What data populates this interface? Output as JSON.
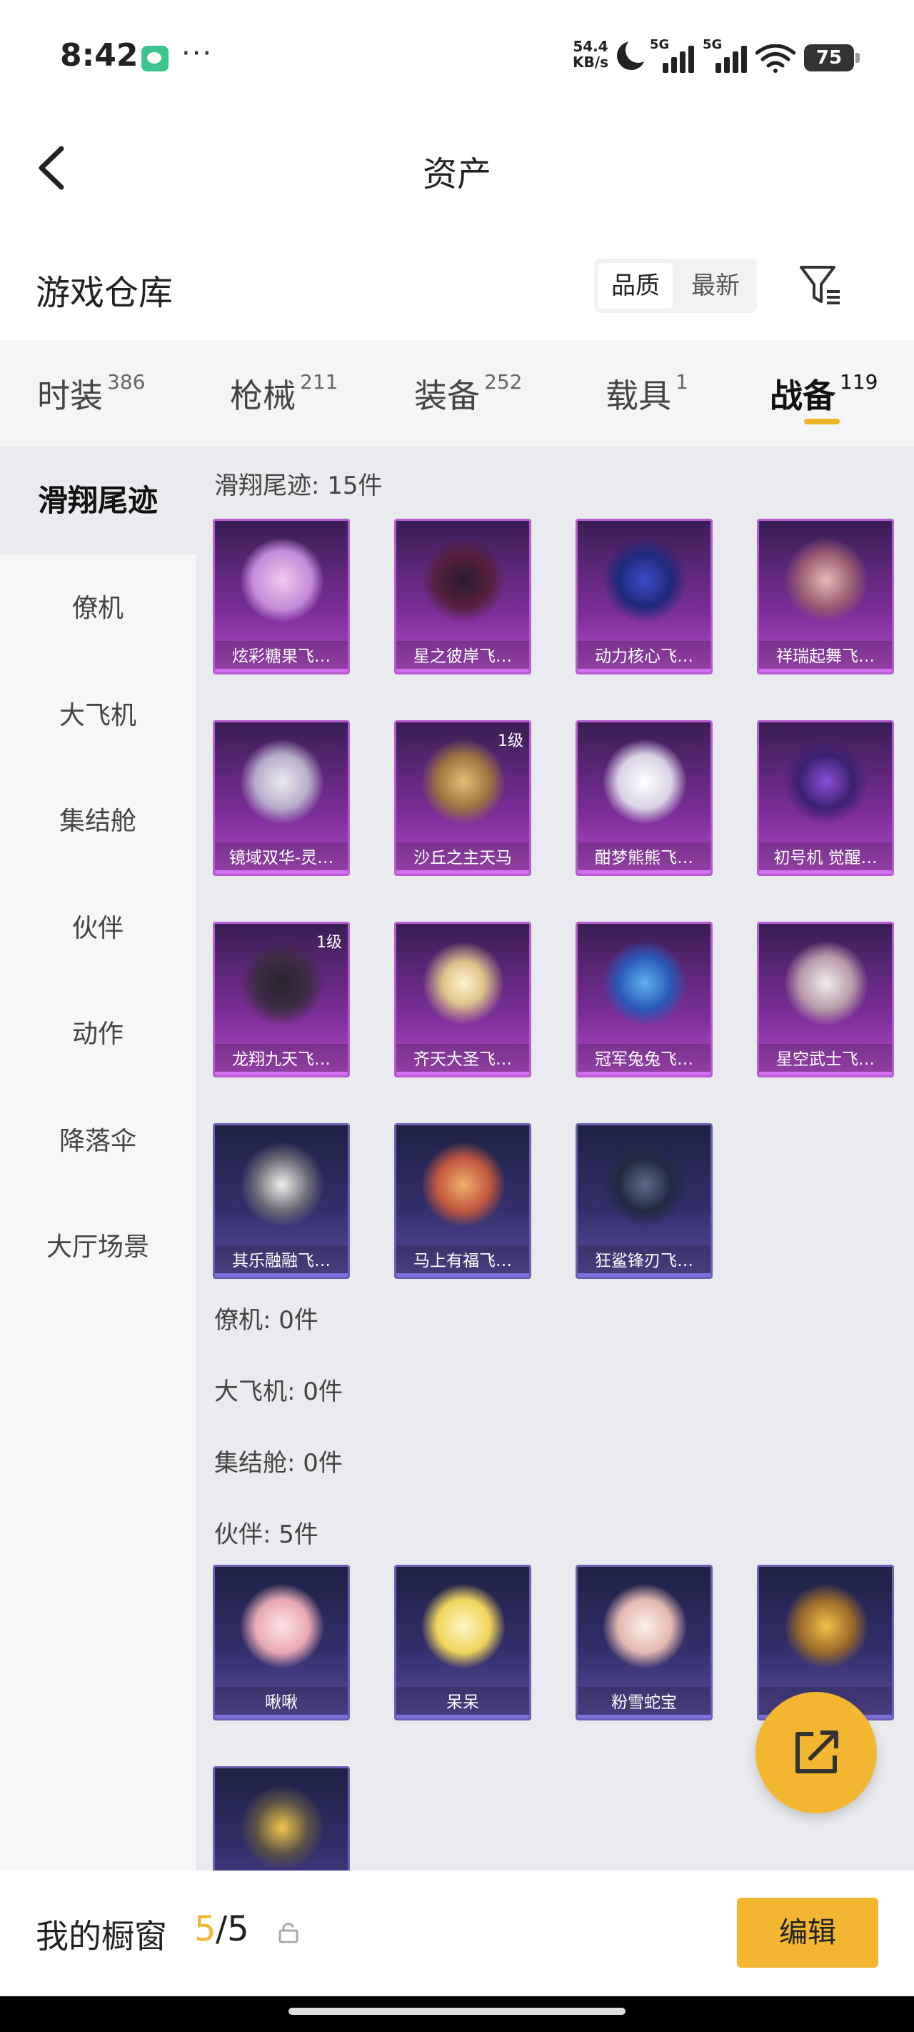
{
  "status_bar": {
    "time": "8:42",
    "dots": "···",
    "net_speed_value": "54.4",
    "net_speed_unit": "KB/s",
    "signal1_label": "5G",
    "signal2_label": "5G",
    "battery": "75",
    "icons": [
      "wechat-icon",
      "moon-icon",
      "signal-icon",
      "wifi-icon",
      "battery-icon"
    ]
  },
  "header": {
    "title": "资产",
    "back_icon": "chevron-left-icon"
  },
  "warehouse": {
    "title": "游戏仓库",
    "sort_quality": "品质",
    "sort_newest": "最新",
    "active_sort": "品质"
  },
  "tabs": [
    {
      "label": "时装",
      "count": "386"
    },
    {
      "label": "枪械",
      "count": "211"
    },
    {
      "label": "装备",
      "count": "252"
    },
    {
      "label": "载具",
      "count": "1"
    },
    {
      "label": "战备",
      "count": "119",
      "active": true
    }
  ],
  "sidebar": [
    "滑翔尾迹",
    "僚机",
    "大飞机",
    "集结舱",
    "伙伴",
    "动作",
    "降落伞",
    "大厅场景"
  ],
  "sections": {
    "trail": {
      "label": "滑翔尾迹: 15件",
      "items": [
        {
          "name": "炫彩糖果飞…",
          "level": ""
        },
        {
          "name": "星之彼岸飞…",
          "level": ""
        },
        {
          "name": "动力核心飞…",
          "level": ""
        },
        {
          "name": "祥瑞起舞飞…",
          "level": ""
        },
        {
          "name": "镜域双华-灵…",
          "level": ""
        },
        {
          "name": "沙丘之主天马",
          "level": "1级"
        },
        {
          "name": "酣梦熊熊飞…",
          "level": ""
        },
        {
          "name": "初号机 觉醒…",
          "level": ""
        },
        {
          "name": "龙翔九天飞…",
          "level": "1级"
        },
        {
          "name": "齐天大圣飞…",
          "level": ""
        },
        {
          "name": "冠军兔兔飞…",
          "level": ""
        },
        {
          "name": "星空武士飞…",
          "level": ""
        },
        {
          "name": "其乐融融飞…",
          "level": ""
        },
        {
          "name": "马上有福飞…",
          "level": ""
        },
        {
          "name": "狂鲨锋刃飞…",
          "level": ""
        }
      ]
    },
    "wingman": {
      "label": "僚机: 0件"
    },
    "big_plane": {
      "label": "大飞机: 0件"
    },
    "assembly": {
      "label": "集结舱: 0件"
    },
    "partner": {
      "label": "伙伴: 5件",
      "items": [
        {
          "name": "啾啾"
        },
        {
          "name": "呆呆"
        },
        {
          "name": "粉雪蛇宝"
        },
        {
          "name": ""
        },
        {
          "name": ""
        }
      ]
    }
  },
  "fab": {
    "icon": "share-external-icon"
  },
  "bottom": {
    "label": "我的橱窗",
    "count_current": "5",
    "count_total": "/5",
    "edit": "编辑"
  },
  "colors": {
    "accent": "#f2b630",
    "purple_card": "#7b2e97",
    "blue_card": "#332f6b"
  }
}
